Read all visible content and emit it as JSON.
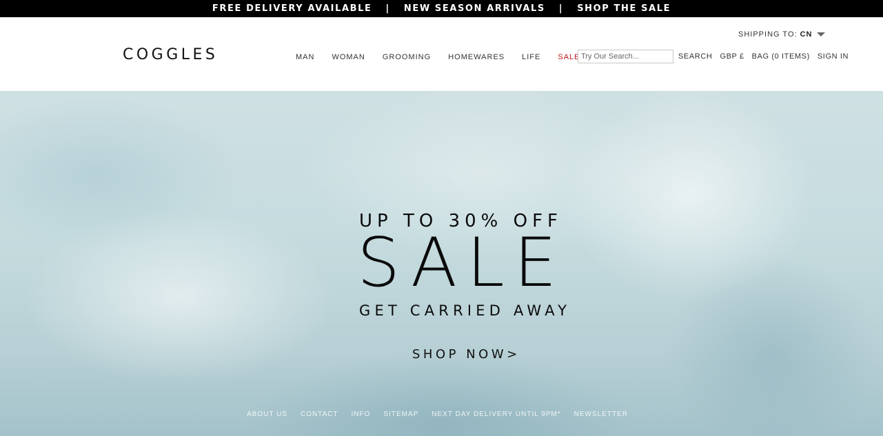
{
  "promo": {
    "items": [
      "FREE DELIVERY AVAILABLE",
      "NEW SEASON ARRIVALS",
      "SHOP THE SALE"
    ],
    "separator": "|"
  },
  "header": {
    "logo": "COGGLES",
    "shipping_label": "SHIPPING TO:",
    "shipping_country": "CN",
    "nav": [
      "MAN",
      "WOMAN",
      "GROOMING",
      "HOMEWARES",
      "LIFE",
      "SALE"
    ],
    "search_placeholder": "Try Our Search...",
    "search_label": "SEARCH",
    "currency": "GBP £",
    "bag": "BAG (0 ITEMS)",
    "sign_in": "SIGN IN"
  },
  "hero": {
    "subtitle": "UP TO 30% OFF",
    "title": "SALE",
    "tagline": "GET CARRIED AWAY",
    "cta": "SHOP NOW>"
  },
  "footer": {
    "links": [
      "ABOUT US",
      "CONTACT",
      "INFO",
      "SITEMAP",
      "NEXT DAY DELIVERY UNTIL 9PM*",
      "NEWSLETTER"
    ]
  },
  "colors": {
    "promo_bg": "#000000",
    "sale_accent": "#c0141c",
    "hero_bg": "#c6dcdf"
  }
}
